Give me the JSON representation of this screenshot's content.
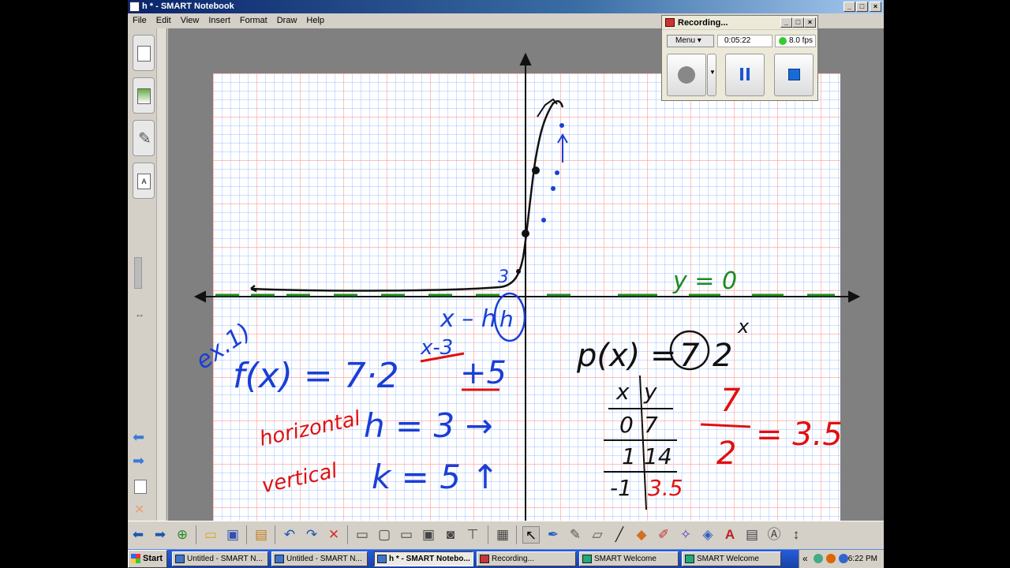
{
  "window": {
    "title": "h * - SMART Notebook",
    "controls": [
      "minimize",
      "maximize",
      "close"
    ]
  },
  "menu": {
    "items": [
      "File",
      "Edit",
      "View",
      "Insert",
      "Format",
      "Draw",
      "Help"
    ]
  },
  "recorder": {
    "title": "Recording...",
    "menu_label": "Menu",
    "elapsed": "0:05:22",
    "fps": "8.0 fps",
    "status_color": "#33cc33"
  },
  "board": {
    "handwriting": {
      "label_ex": "ex.1)",
      "function": "f(x) = 7·2",
      "exponent": "x-3",
      "plus": "+5",
      "x_minus_h": "x – h",
      "h_circle": "h",
      "small_3": "3",
      "y_eq": "y = 0",
      "horizontal": "horizontal",
      "vertical": "vertical",
      "h_value": "h = 3 →",
      "k_value": "k = 5 ↑",
      "parent": "p(x) =",
      "parent_coef": "7",
      "parent_base": "2",
      "parent_exp": "x",
      "table_head_x": "x",
      "table_head_y": "y",
      "table_rows": [
        [
          "0",
          "7"
        ],
        [
          "1",
          "14"
        ],
        [
          "-1",
          "3.5"
        ]
      ],
      "frac_num": "7",
      "frac_den": "2",
      "frac_result": "= 3.5"
    },
    "colors": {
      "blue": "#1a3fd6",
      "red": "#e01010",
      "black": "#111111",
      "green": "#1f8a1f",
      "grid_minor": "#8fb4ff",
      "grid_major": "#ff8080"
    }
  },
  "toolbar": {
    "icons": [
      "back-arrow-icon",
      "forward-arrow-icon",
      "add-page-icon",
      "open-folder-icon",
      "save-icon",
      "paste-icon",
      "undo-icon",
      "redo-icon",
      "delete-icon",
      "screen-shade-icon",
      "full-screen-icon",
      "dual-page-icon",
      "capture-icon",
      "insert-picture-icon",
      "table-icon",
      "select-arrow-icon",
      "pen-icon",
      "creative-pen-icon",
      "eraser-icon",
      "line-icon",
      "fill-icon",
      "highlighter-icon",
      "magic-pen-icon",
      "shape-recognition-icon",
      "text-icon",
      "properties-icon",
      "font-icon",
      "toolbar-move-icon"
    ]
  },
  "taskbar": {
    "start": "Start",
    "tasks": [
      {
        "label": "Untitled - SMART N...",
        "active": false
      },
      {
        "label": "Untitled - SMART N...",
        "active": false
      },
      {
        "label": "h * - SMART Notebo...",
        "active": true
      },
      {
        "label": "Recording...",
        "active": false
      },
      {
        "label": "SMART Welcome",
        "active": false
      },
      {
        "label": "SMART Welcome",
        "active": false
      }
    ],
    "clock": "6:22 PM",
    "tray_chevron": "«"
  }
}
